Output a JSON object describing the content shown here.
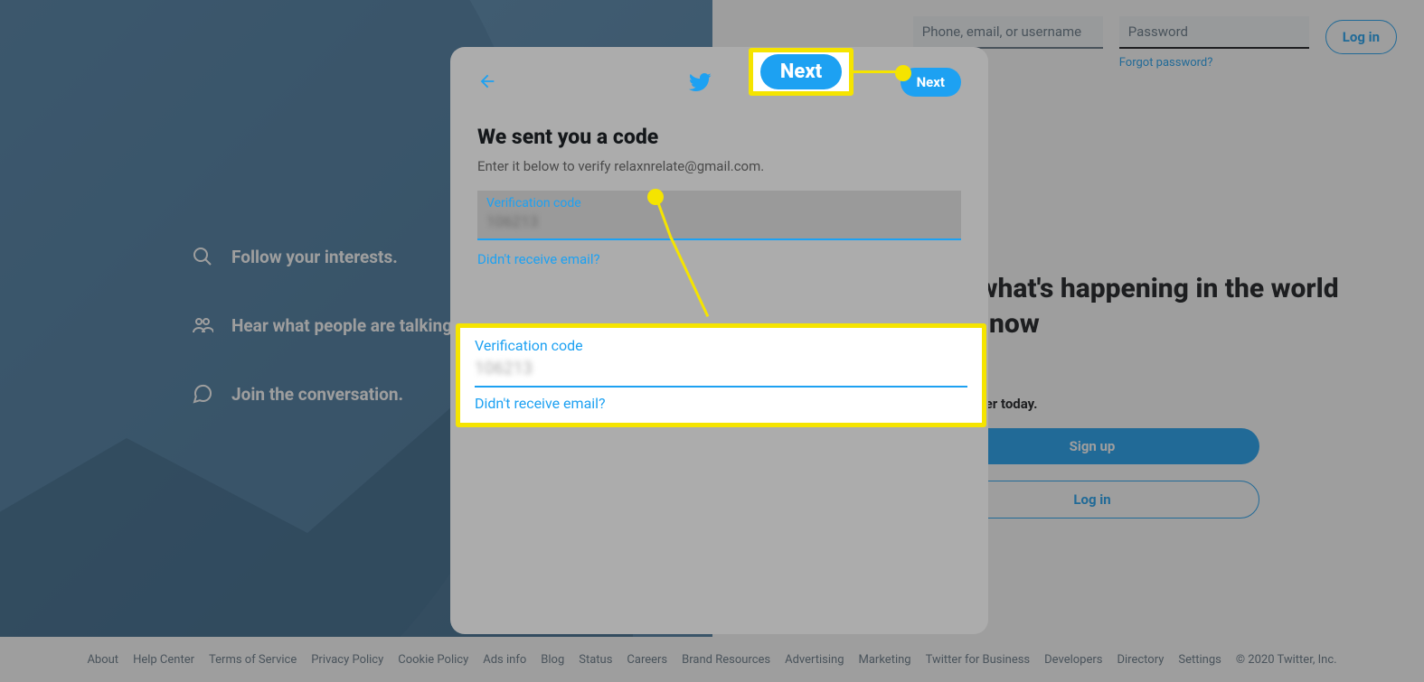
{
  "left_panel": {
    "features": [
      {
        "icon": "search-icon",
        "label": "Follow your interests."
      },
      {
        "icon": "people-icon",
        "label": "Hear what people are talking about."
      },
      {
        "icon": "chat-icon",
        "label": "Join the conversation."
      }
    ]
  },
  "header": {
    "phone_placeholder": "Phone, email, or username",
    "password_placeholder": "Password",
    "login_label": "Log in",
    "forgot_label": "Forgot password?"
  },
  "hero": {
    "title": "See what's happening in the world right now",
    "sub": "Join Twitter today.",
    "signup_label": "Sign up",
    "login_label": "Log in"
  },
  "modal": {
    "next_label": "Next",
    "title": "We sent you a code",
    "sub": "Enter it below to verify relaxnrelate@gmail.com.",
    "input_label": "Verification code",
    "input_value": "106213",
    "resend_label": "Didn't receive email?"
  },
  "callouts": {
    "next_label": "Next",
    "input_label": "Verification code",
    "input_value": "106213",
    "resend_label": "Didn't receive email?"
  },
  "footer": {
    "links": [
      "About",
      "Help Center",
      "Terms of Service",
      "Privacy Policy",
      "Cookie Policy",
      "Ads info",
      "Blog",
      "Status",
      "Careers",
      "Brand Resources",
      "Advertising",
      "Marketing",
      "Twitter for Business",
      "Developers",
      "Directory",
      "Settings"
    ],
    "copyright": "© 2020 Twitter, Inc."
  }
}
